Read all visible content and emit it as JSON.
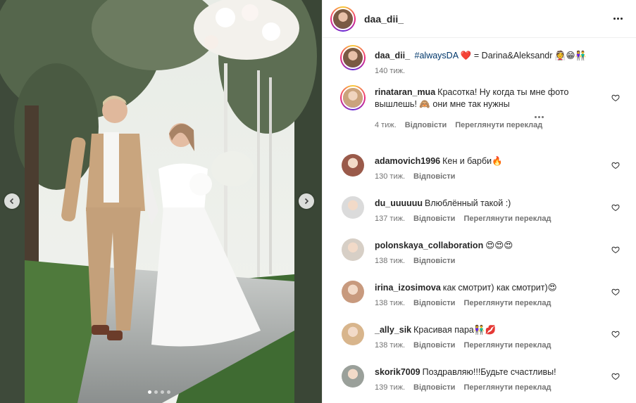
{
  "post": {
    "author": "daa_dii_",
    "caption": {
      "user": "daa_dii_",
      "hashtag": "#alwaysDA",
      "text_after": "= Darina&Aleksandr",
      "emoji_heart": "❤️",
      "emoji_tail": "👰😁👫",
      "time": "140 тиж."
    },
    "carousel": {
      "dot_count": 4,
      "active_index": 0
    }
  },
  "labels": {
    "reply": "Відповісти",
    "translate": "Переглянути переклад"
  },
  "comments": [
    {
      "user": "rinataran_mua",
      "text": "Красотка! Ну когда ты мне фото",
      "text2": "вышлешь! 🙈 они мне так нужны",
      "time": "4 тиж.",
      "translate": true,
      "avatar_color": "#caa37c",
      "story_ring": true
    },
    {
      "user": "adamovich1996",
      "text": "Кен и барби🔥",
      "time": "130 тиж.",
      "translate": false,
      "avatar_color": "#9a5a4a",
      "story_ring": false
    },
    {
      "user": "du_uuuuuu",
      "text": "Влюблённый такой :)",
      "time": "137 тиж.",
      "translate": true,
      "avatar_color": "#dbdbdb",
      "story_ring": false
    },
    {
      "user": "polonskaya_collaboration",
      "text": "😍😍😍",
      "time": "138 тиж.",
      "translate": false,
      "avatar_color": "#d7cfc6",
      "story_ring": false
    },
    {
      "user": "irina_izosimova",
      "text": "как смотрит) как смотрит)😍",
      "time": "138 тиж.",
      "translate": true,
      "avatar_color": "#c89a7e",
      "story_ring": false
    },
    {
      "user": "_ally_sik",
      "text": "Красивая пара👫💋",
      "time": "138 тиж.",
      "translate": true,
      "avatar_color": "#d8b58c",
      "story_ring": false
    },
    {
      "user": "skorik7009",
      "text": "Поздравляю!!!Будьте счастливы!",
      "time": "139 тиж.",
      "translate": true,
      "avatar_color": "#9aa09a",
      "story_ring": false
    }
  ]
}
